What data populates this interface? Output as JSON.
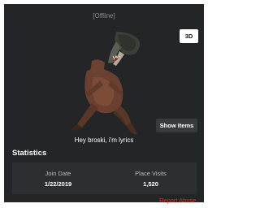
{
  "profile": {
    "presence": "[Offline]",
    "view_mode_button": "3D",
    "show_items_button": "Show Items",
    "status_message": "Hey broski, i'm lyrics"
  },
  "statistics": {
    "title": "Statistics",
    "items": [
      {
        "label": "Join Date",
        "value": "1/22/2019"
      },
      {
        "label": "Place Visits",
        "value": "1,520"
      }
    ]
  },
  "report_abuse": "Report Abuse",
  "colors": {
    "panel": "#232527",
    "stats_box": "#2c2e30",
    "report_link": "#e5271e"
  }
}
